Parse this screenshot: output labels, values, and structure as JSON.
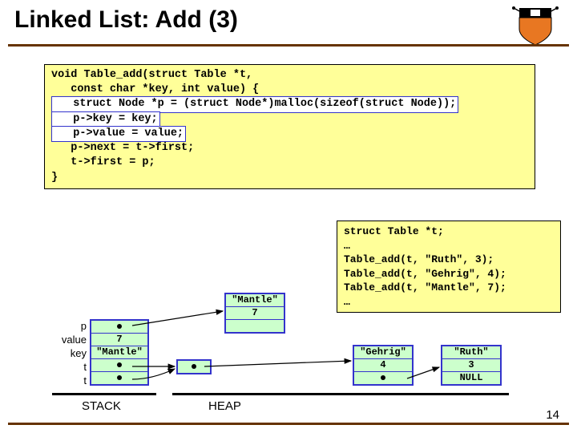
{
  "title": "Linked List: Add (3)",
  "pagenum": "14",
  "code_main": {
    "l1": "void Table_add(struct Table *t,",
    "l2": "   const char *key, int value) {",
    "hl1": "   struct Node *p = (struct Node*)malloc(sizeof(struct Node));",
    "hl2": "   p->key = key;",
    "hl3": "   p->value = value;",
    "l3": "   p->next = t->first;",
    "l4": "   t->first = p;",
    "l5": "}"
  },
  "code_side": {
    "l1": "struct Table *t;",
    "l2": "…",
    "l3": "Table_add(t, \"Ruth\", 3);",
    "l4": "Table_add(t, \"Gehrig\", 4);",
    "l5": "Table_add(t, \"Mantle\", 7);",
    "l6": "…"
  },
  "stack": {
    "labels": [
      "p",
      "value",
      "key",
      "t",
      "t"
    ],
    "cells": [
      "",
      "7",
      "\"Mantle\"",
      "",
      ""
    ]
  },
  "heap": {
    "mantle": {
      "key": "\"Mantle\"",
      "value": "7"
    },
    "gehrig": {
      "key": "\"Gehrig\"",
      "value": "4"
    },
    "ruth": {
      "key": "\"Ruth\"",
      "value": "3",
      "next": "NULL"
    }
  },
  "captions": {
    "stack": "STACK",
    "heap": "HEAP"
  }
}
